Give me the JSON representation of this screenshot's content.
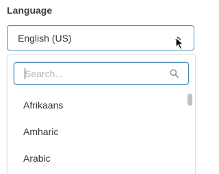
{
  "field": {
    "label": "Language",
    "selected_value": "English (US)"
  },
  "dropdown": {
    "search_placeholder": "Search...",
    "search_value": "",
    "options": [
      {
        "label": "Afrikaans"
      },
      {
        "label": "Amharic"
      },
      {
        "label": "Arabic"
      }
    ]
  },
  "icons": {
    "select": "chevron-up-icon",
    "search": "search-icon",
    "pointer": "mouse-pointer-icon"
  },
  "colors": {
    "focus_border": "#4a8db8",
    "text": "#333333",
    "placeholder": "#b5b5b5"
  }
}
